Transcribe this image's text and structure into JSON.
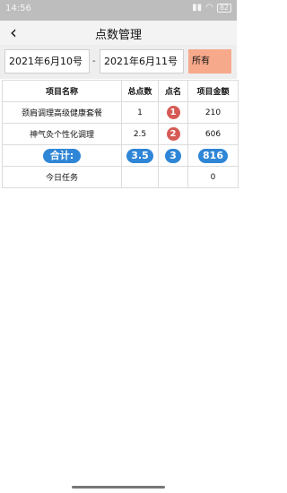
{
  "status_bar": {
    "time": "14:56",
    "icons": [
      "signal-icon",
      "wifi-icon",
      "battery-icon"
    ],
    "battery_level": "82"
  },
  "header": {
    "title": "点数管理"
  },
  "filter": {
    "start_date": "2021年6月10号",
    "separator": "-",
    "end_date": "2021年6月11号",
    "select_value": "所有"
  },
  "table": {
    "headers": [
      "项目名称",
      "总点数",
      "点名",
      "项目金额"
    ],
    "rows": [
      {
        "name": "颈肩调理高级健康套餐",
        "points": "1",
        "rank": "1",
        "amount": "210"
      },
      {
        "name": "神气灸个性化调理",
        "points": "2.5",
        "rank": "2",
        "amount": "606"
      }
    ],
    "total": {
      "label": "合计:",
      "points": "3.5",
      "rank": "3",
      "amount": "816"
    },
    "today": {
      "label": "今日任务",
      "points": "",
      "rank": "",
      "amount": "0"
    }
  },
  "colors": {
    "accent_pill": "#2f86d6",
    "rank_badge": "#d65a55",
    "filter_select_bg": "#f7a98b"
  }
}
